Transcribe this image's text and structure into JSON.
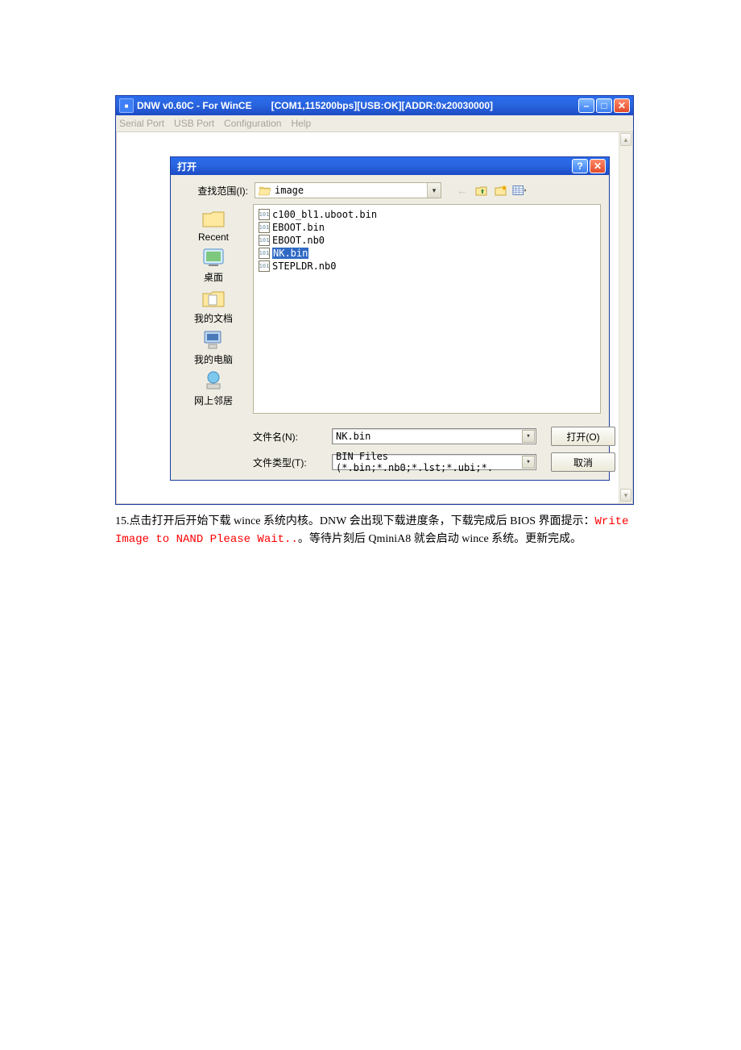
{
  "outerWindow": {
    "title1": "DNW v0.60C - For WinCE",
    "title2": "[COM1,115200bps][USB:OK][ADDR:0x20030000]"
  },
  "menu": {
    "serial": "Serial Port",
    "usb": "USB Port",
    "config": "Configuration",
    "help": "Help"
  },
  "dialog": {
    "title": "打开",
    "lookinLabel": "查找范围(I):",
    "lookinValue": "image",
    "places": {
      "recent": "Recent",
      "desktop": "桌面",
      "mydocs": "我的文档",
      "mycomputer": "我的电脑",
      "network": "网上邻居"
    },
    "files": [
      "c100_bl1.uboot.bin",
      "EBOOT.bin",
      "EBOOT.nb0",
      "NK.bin",
      "STEPLDR.nb0"
    ],
    "selectedIndex": 3,
    "filenameLabel": "文件名(N):",
    "filenameValue": "NK.bin",
    "filetypeLabel": "文件类型(T):",
    "filetypeValue": "BIN Files (*.bin;*.nb0;*.lst;*.ubi;*.",
    "openLabel": "打开(O)",
    "cancelLabel": "取消"
  },
  "caption": {
    "line1a": "15.点击打开后开始下载 wince 系统内核。DNW 会出现下载进度条，下载完成后 BIOS 界面提示：",
    "redPart": "Write Image to NAND Please Wait..",
    "line1b": "。等待片刻后 QminiA8 就会启动 wince 系统。更新完成。"
  }
}
